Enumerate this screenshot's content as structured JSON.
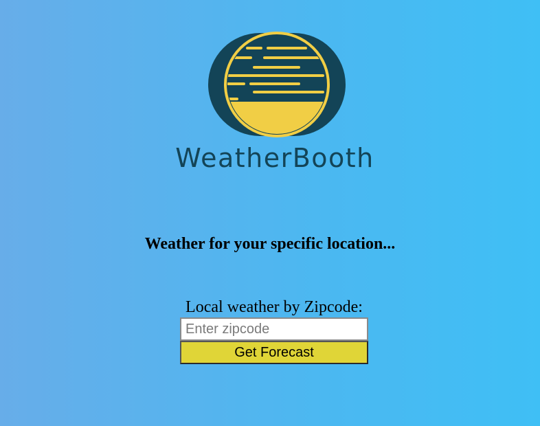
{
  "brand": {
    "name": "WeatherBooth",
    "logo_icon": "sun-behind-cloud-logo",
    "colors": {
      "logo_dark": "#134457",
      "logo_sun": "#f1ce45",
      "logo_text": "#134457"
    }
  },
  "tagline": "Weather for your specific location...",
  "zip_form": {
    "label": "Local weather by Zipcode:",
    "input_placeholder": "Enter zipcode",
    "input_value": "",
    "submit_label": "Get Forecast"
  },
  "theme": {
    "background_gradient": [
      "#67ade9",
      "#3fbff5"
    ],
    "button_color": "#e0d537"
  }
}
